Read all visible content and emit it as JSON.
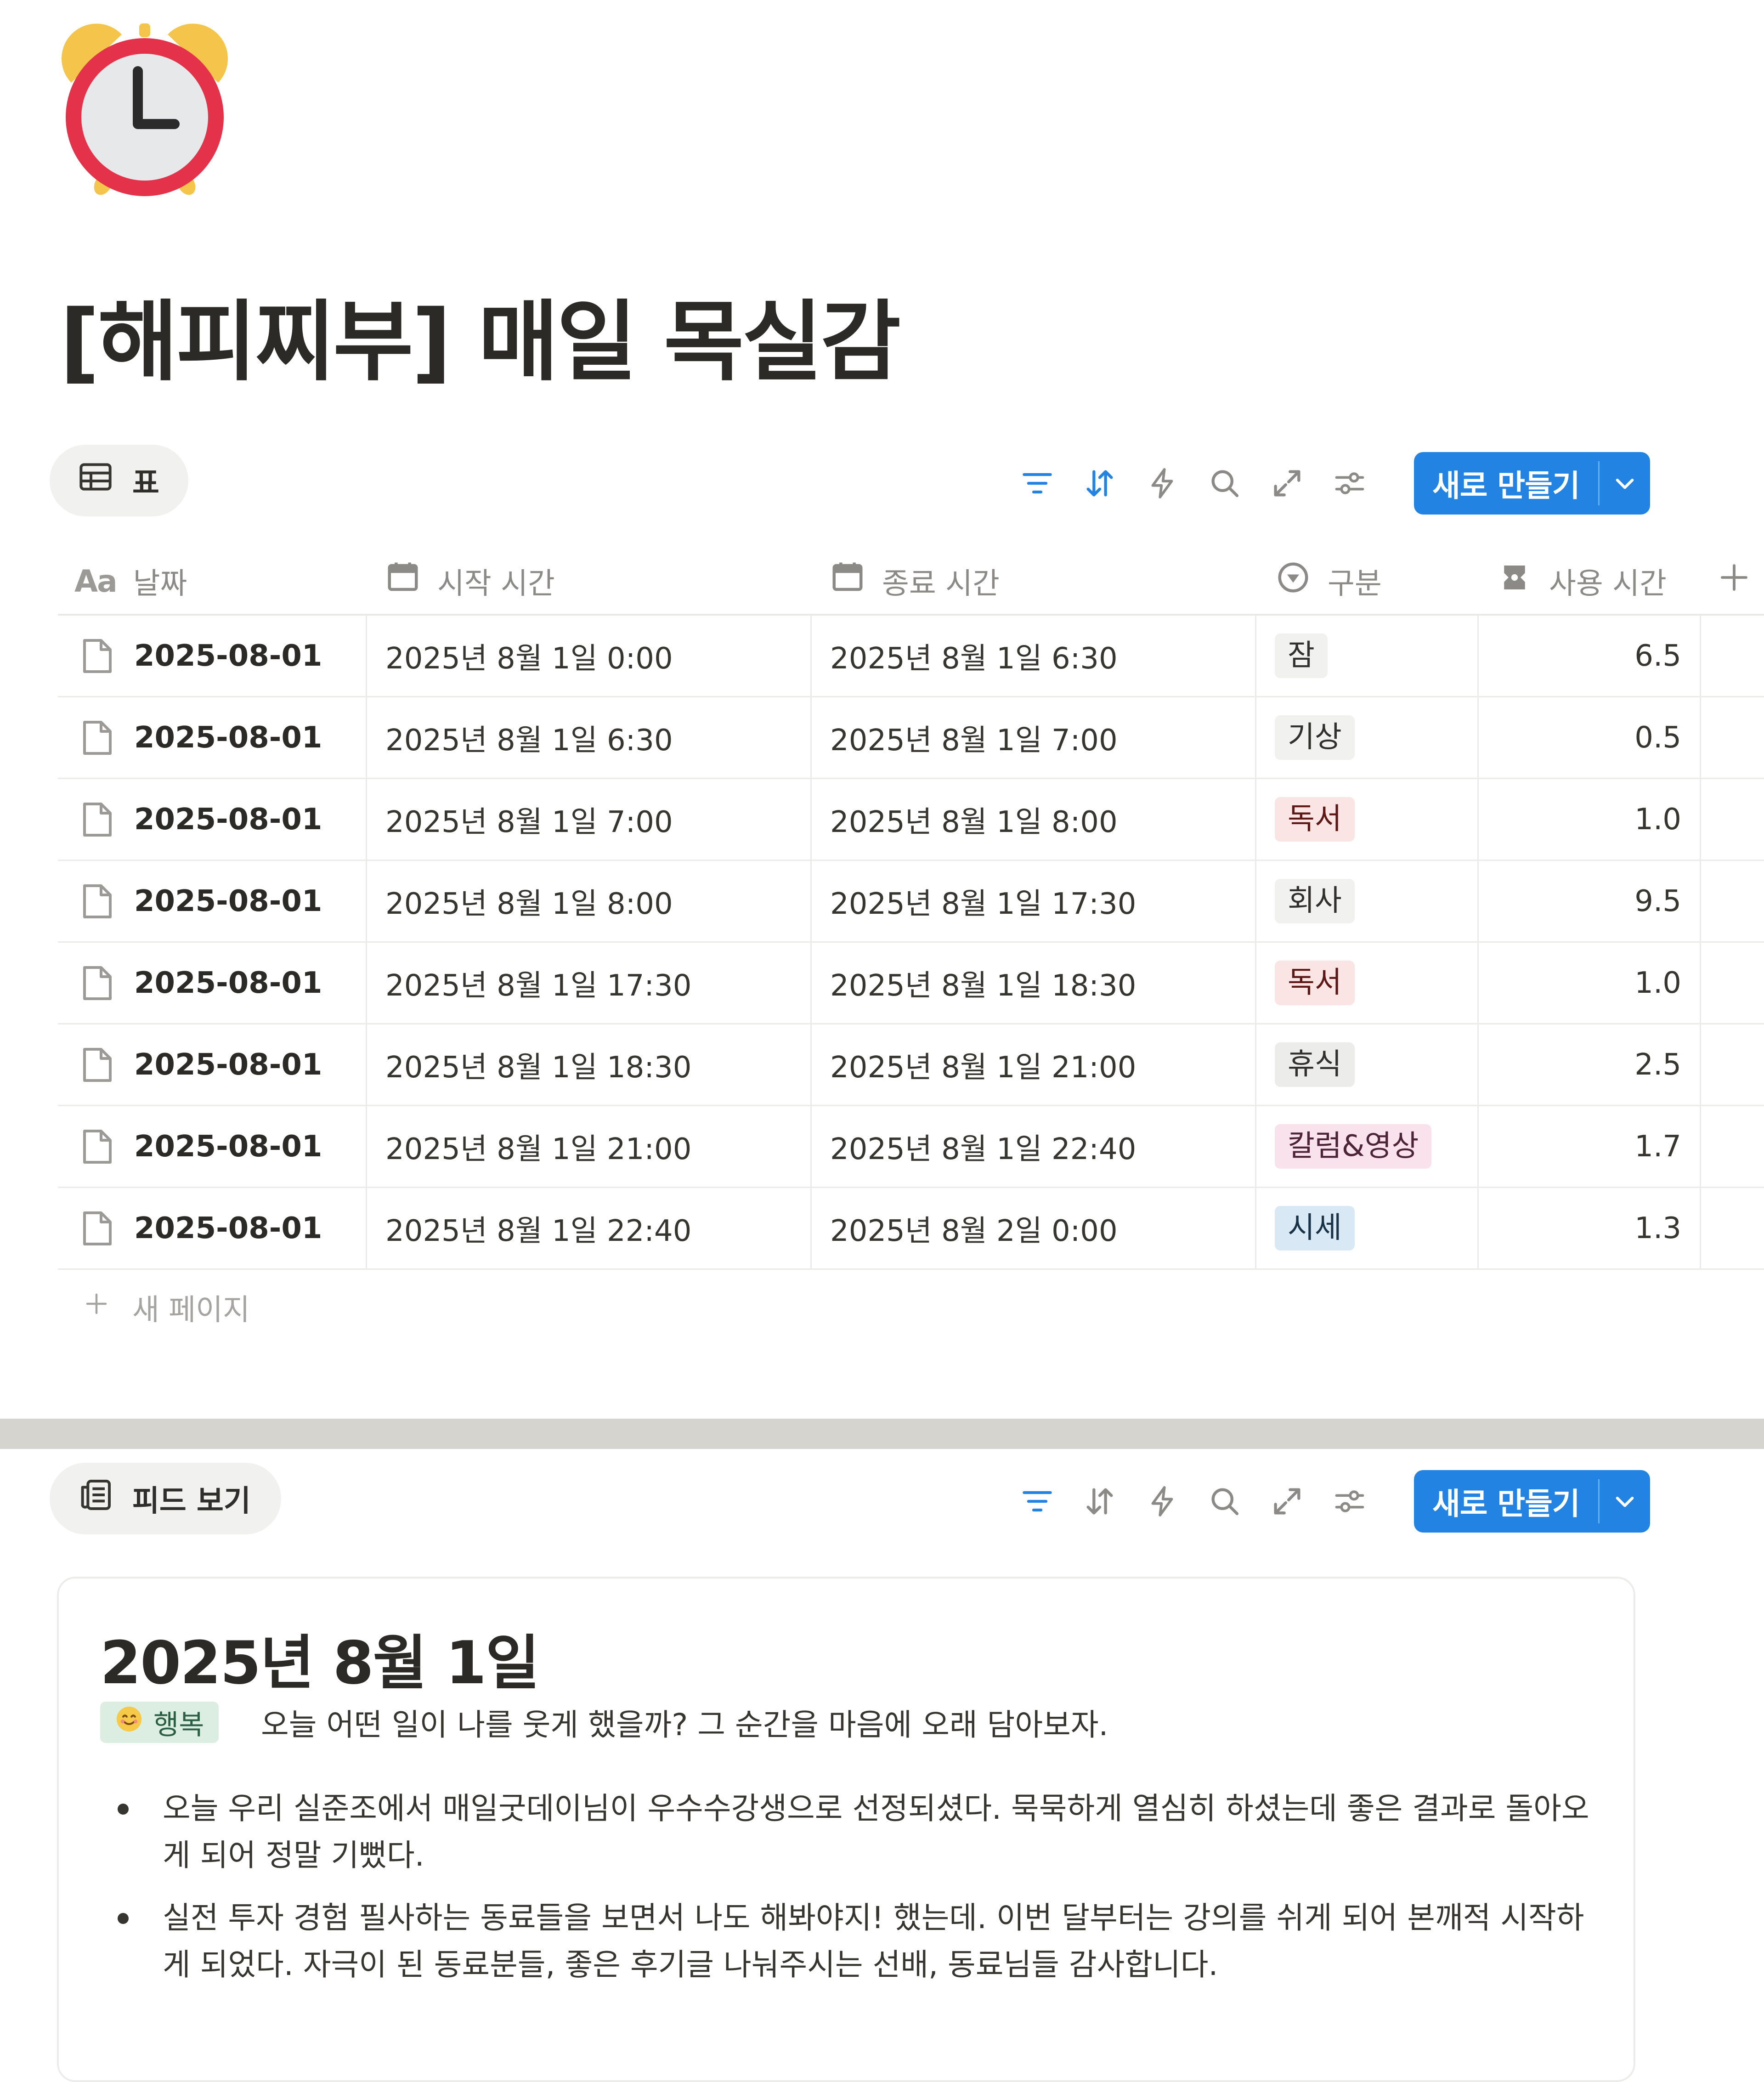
{
  "page": {
    "icon": "alarm-clock-icon",
    "title": "[해피찌부] 매일 목실감"
  },
  "table_view": {
    "tab_label": "표",
    "new_button_label": "새로 만들기",
    "columns": [
      {
        "icon": "text-aa-icon",
        "icon_text": "Aa",
        "label": "날짜"
      },
      {
        "icon": "calendar-icon",
        "label": "시작 시간"
      },
      {
        "icon": "calendar-icon",
        "label": "종료 시간"
      },
      {
        "icon": "select-icon",
        "label": "구분"
      },
      {
        "icon": "formula-icon",
        "label": "사용 시간"
      }
    ],
    "rows": [
      {
        "date": "2025-08-01",
        "start": "2025년 8월 1일 0:00",
        "end": "2025년 8월 1일 6:30",
        "category": "잠",
        "hours": "6.5"
      },
      {
        "date": "2025-08-01",
        "start": "2025년 8월 1일 6:30",
        "end": "2025년 8월 1일 7:00",
        "category": "기상",
        "hours": "0.5"
      },
      {
        "date": "2025-08-01",
        "start": "2025년 8월 1일 7:00",
        "end": "2025년 8월 1일 8:00",
        "category": "독서",
        "hours": "1.0"
      },
      {
        "date": "2025-08-01",
        "start": "2025년 8월 1일 8:00",
        "end": "2025년 8월 1일 17:30",
        "category": "회사",
        "hours": "9.5"
      },
      {
        "date": "2025-08-01",
        "start": "2025년 8월 1일 17:30",
        "end": "2025년 8월 1일 18:30",
        "category": "독서",
        "hours": "1.0"
      },
      {
        "date": "2025-08-01",
        "start": "2025년 8월 1일 18:30",
        "end": "2025년 8월 1일 21:00",
        "category": "휴식",
        "hours": "2.5"
      },
      {
        "date": "2025-08-01",
        "start": "2025년 8월 1일 21:00",
        "end": "2025년 8월 1일 22:40",
        "category": "칼럼&영상",
        "hours": "1.7"
      },
      {
        "date": "2025-08-01",
        "start": "2025년 8월 1일 22:40",
        "end": "2025년 8월 2일 0:00",
        "category": "시세",
        "hours": "1.3"
      }
    ],
    "category_colors": {
      "잠": {
        "bg": "#f1f1ef",
        "fg": "#32302c"
      },
      "기상": {
        "bg": "#f1f1ef",
        "fg": "#32302c"
      },
      "독서": {
        "bg": "#fbe4e4",
        "fg": "#5d1715"
      },
      "회사": {
        "bg": "#f1f1ef",
        "fg": "#32302c"
      },
      "휴식": {
        "bg": "#ececeb",
        "fg": "#32302c"
      },
      "칼럼&영상": {
        "bg": "#f9e2ec",
        "fg": "#4c2337"
      },
      "시세": {
        "bg": "#d8e8f5",
        "fg": "#183347"
      }
    },
    "new_page_label": "새 페이지"
  },
  "feed_view": {
    "tab_label": "피드 보기",
    "new_button_label": "새로 만들기",
    "card": {
      "title": "2025년 8월 1일",
      "mood_icon": "smiling-face-icon",
      "mood_label": "행복",
      "prompt": "오늘 어떤 일이 나를 웃게 했을까? 그 순간을 마음에 오래 담아보자.",
      "bullets": [
        "오늘 우리 실준조에서 매일굿데이님이 우수수강생으로 선정되셨다. 묵묵하게 열심히 하셨는데 좋은 결과로 돌아오게 되어 정말 기뻤다.",
        "실전 투자 경험 필사하는 동료들을 보면서 나도 해봐야지! 했는데. 이번 달부터는 강의를 쉬게 되어 본깨적 시작하게 되었다. 자극이 된 동료분들, 좋은 후기글 나눠주시는 선배, 동료님들 감사합니다."
      ]
    }
  },
  "colors": {
    "accent": "#2383e2",
    "text": "#37352f",
    "muted": "#8b8a86",
    "divider": "#d6d4cf"
  }
}
